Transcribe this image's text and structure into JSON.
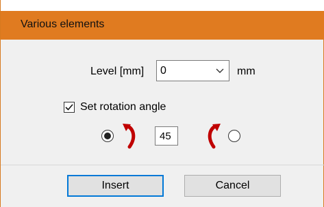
{
  "dialog": {
    "title": "Various elements"
  },
  "level": {
    "label": "Level [mm]",
    "value": "0",
    "unit": "mm"
  },
  "rotation": {
    "checkbox_label": "Set rotation angle",
    "checked": true,
    "angle_value": "45",
    "left_radio_selected": true,
    "right_radio_selected": false,
    "left_icon": "rotate-clockwise-arrow-icon",
    "right_icon": "rotate-counterclockwise-arrow-icon",
    "icon_color": "#c00000"
  },
  "buttons": {
    "insert_label": "Insert",
    "cancel_label": "Cancel"
  },
  "colors": {
    "titlebar": "#e07b20",
    "focus": "#0078d7"
  }
}
